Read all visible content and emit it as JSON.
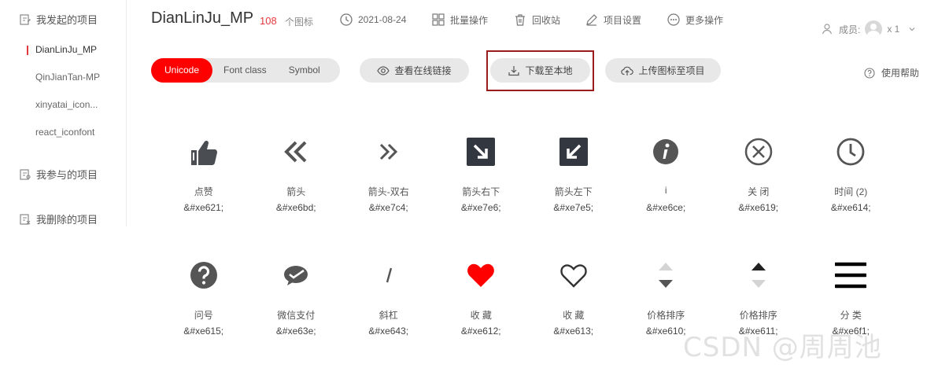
{
  "sidebar": {
    "created_label": "我发起的项目",
    "projects": [
      {
        "label": "DianLinJu_MP"
      },
      {
        "label": "QinJianTan-MP"
      },
      {
        "label": "xinyatai_icon..."
      },
      {
        "label": "react_iconfont"
      }
    ],
    "joined_label": "我参与的项目",
    "deleted_label": "我删除的项目"
  },
  "header": {
    "title": "DianLinJu_MP",
    "icon_count": "108",
    "icon_count_label": "个图标",
    "date": "2021-08-24",
    "batch_label": "批量操作",
    "recycle_label": "回收站",
    "settings_label": "项目设置",
    "more_label": "更多操作",
    "members_label": "成员:",
    "members_count": "x 1"
  },
  "toolbar": {
    "tabs": [
      "Unicode",
      "Font class",
      "Symbol"
    ],
    "view_online_label": "查看在线链接",
    "download_label": "下载至本地",
    "upload_label": "上传图标至项目",
    "help_label": "使用帮助"
  },
  "icons": [
    {
      "name": "点赞",
      "code": "&#xe621;",
      "icon": "thumbs-up-icon"
    },
    {
      "name": "箭头",
      "code": "&#xe6bd;",
      "icon": "double-chevron-left-icon"
    },
    {
      "name": "箭头-双右",
      "code": "&#xe7c4;",
      "icon": "double-chevron-right-icon"
    },
    {
      "name": "箭头右下",
      "code": "&#xe7e6;",
      "icon": "arrow-down-right-icon"
    },
    {
      "name": "箭头左下",
      "code": "&#xe7e5;",
      "icon": "arrow-down-left-icon"
    },
    {
      "name": "i",
      "code": "&#xe6ce;",
      "icon": "info-icon"
    },
    {
      "name": "关 闭",
      "code": "&#xe619;",
      "icon": "close-circle-icon"
    },
    {
      "name": "时间 (2)",
      "code": "&#xe614;",
      "icon": "clock-icon"
    },
    {
      "name": "问号",
      "code": "&#xe615;",
      "icon": "question-icon"
    },
    {
      "name": "微信支付",
      "code": "&#xe63e;",
      "icon": "wechat-pay-icon"
    },
    {
      "name": "斜杠",
      "code": "&#xe643;",
      "icon": "slash-icon"
    },
    {
      "name": "收 藏",
      "code": "&#xe612;",
      "icon": "heart-filled-icon"
    },
    {
      "name": "收 藏",
      "code": "&#xe613;",
      "icon": "heart-outline-icon"
    },
    {
      "name": "价格排序",
      "code": "&#xe610;",
      "icon": "sort-down-icon"
    },
    {
      "name": "价格排序",
      "code": "&#xe611;",
      "icon": "sort-up-icon"
    },
    {
      "name": "分 类",
      "code": "&#xe6f1;",
      "icon": "menu-icon"
    }
  ],
  "watermark": "CSDN @周周池",
  "colors": {
    "accent": "#ff0000",
    "icon_dark": "#333840",
    "heart": "#ff0000",
    "frame": "#9b1c1c"
  }
}
